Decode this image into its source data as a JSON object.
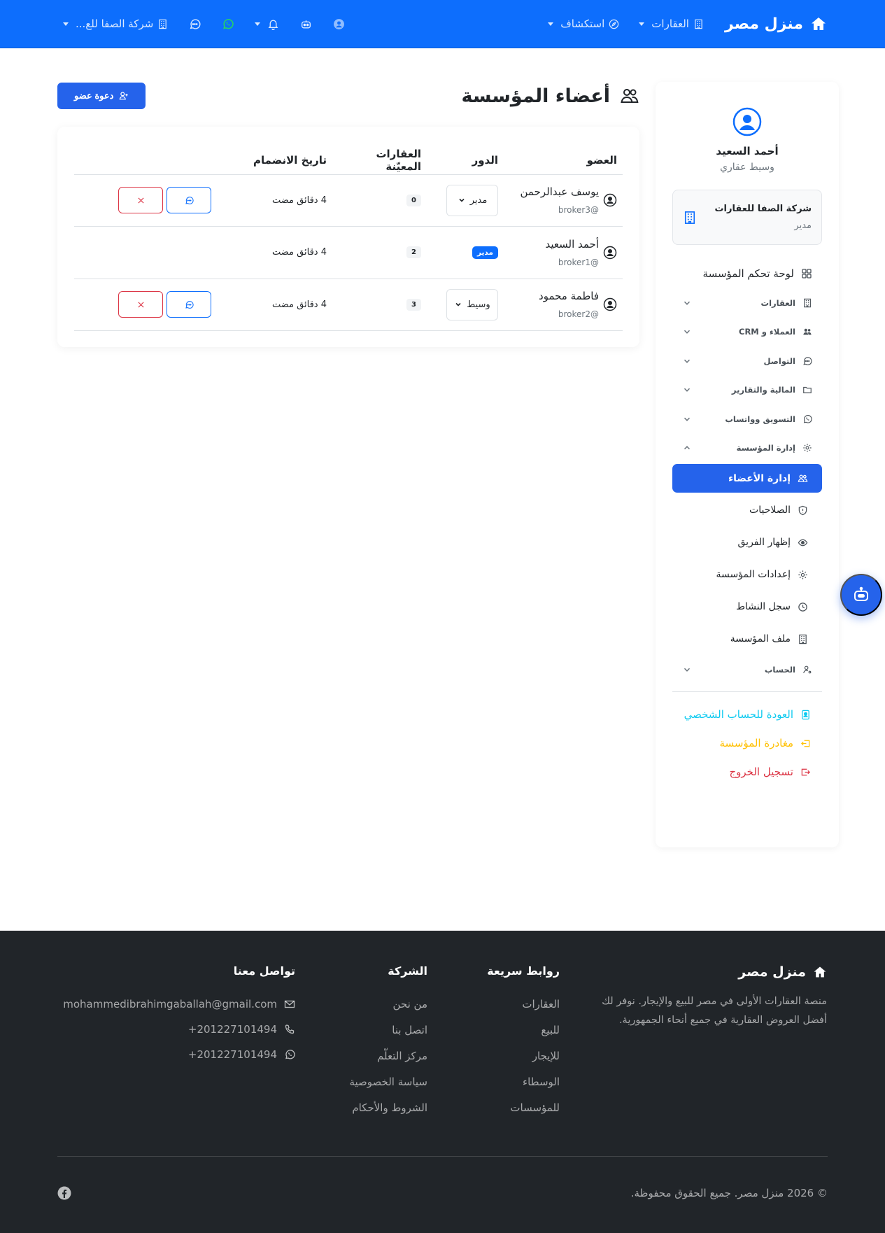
{
  "navbar": {
    "brand": "منزل مصر",
    "properties_label": "العقارات",
    "explore_label": "استكشاف",
    "org_switch_label": "شركة الصفا للع..."
  },
  "sidebar": {
    "user_name": "أحمد السعيد",
    "user_role": "وسيط عقاري",
    "org_name": "شركة الصفا للعقارات",
    "org_role": "مدير",
    "dashboard": "لوحة تحكم المؤسسة",
    "groups": [
      "العقارات",
      "العملاء و CRM",
      "التواصل",
      "المالية والتقارير",
      "التسويق وواتساب",
      "إدارة المؤسسة"
    ],
    "sub_items": [
      "إدارة الأعضاء",
      "الصلاحيات",
      "إظهار الفريق",
      "إعدادات المؤسسة",
      "سجل النشاط",
      "ملف المؤسسة"
    ],
    "account_group": "الحساب",
    "back_to_personal": "العودة للحساب الشخصي",
    "leave_org": "مغادرة المؤسسة",
    "logout": "تسجيل الخروج"
  },
  "page": {
    "title": "أعضاء المؤسسة",
    "invite_label": "دعوة عضو"
  },
  "table": {
    "headers": {
      "member": "العضو",
      "role": "الدور",
      "properties": "العقارات المعيّنة",
      "joined": "تاريخ الانضمام"
    },
    "rows": [
      {
        "name": "يوسف عبدالرحمن",
        "handle": "broker3@",
        "role": "مدير",
        "properties": "0",
        "joined": "4 دقائق مضت"
      },
      {
        "name": "أحمد السعيد",
        "handle": "broker1@",
        "role": "مدير",
        "properties": "2",
        "joined": "4 دقائق مضت"
      },
      {
        "name": "فاطمة محمود",
        "handle": "broker2@",
        "role": "وسيط",
        "properties": "3",
        "joined": "4 دقائق مضت"
      }
    ]
  },
  "footer": {
    "brand": "منزل مصر",
    "description": "منصة العقارات الأولى في مصر للبيع والإيجار. نوفر لك أفضل العروض العقارية في جميع أنحاء الجمهورية.",
    "quick_links_title": "روابط سريعة",
    "quick_links": [
      "العقارات",
      "للبيع",
      "للإيجار",
      "الوسطاء",
      "للمؤسسات"
    ],
    "company_title": "الشركة",
    "company_links": [
      "من نحن",
      "اتصل بنا",
      "مركز التعلّم",
      "سياسة الخصوصية",
      "الشروط والأحكام"
    ],
    "contact_title": "تواصل معنا",
    "email": "mohammedibrahimgaballah@gmail.com",
    "phone": "201227101494+",
    "whatsapp": "201227101494+",
    "copyright": "© 2026 منزل مصر. جميع الحقوق محفوظة."
  },
  "colors": {
    "primary": "#0d6efd",
    "accent": "#2563eb",
    "footer_bg": "#212529",
    "danger": "#dc3545",
    "warning": "#ffc107",
    "info": "#0dcaf0",
    "whatsapp": "#25d366"
  }
}
